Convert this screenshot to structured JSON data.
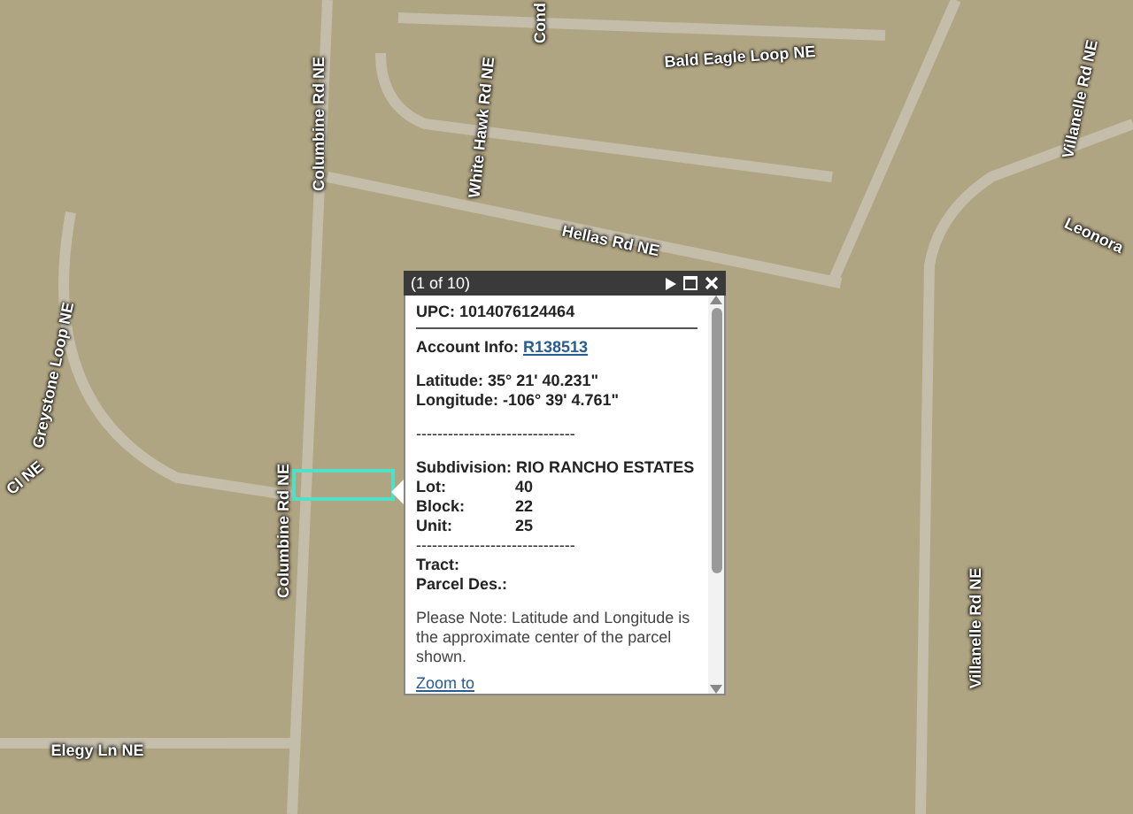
{
  "map": {
    "labels": [
      {
        "text": "Cond"
      },
      {
        "text": "Bald Eagle Loop NE"
      },
      {
        "text": "Columbine Rd NE"
      },
      {
        "text": "White Hawk Rd NE"
      },
      {
        "text": "Hellas Rd NE"
      },
      {
        "text": "Villanelle Rd NE"
      },
      {
        "text": "Leonora"
      },
      {
        "text": "Greystone Loop NE"
      },
      {
        "text": "Cl NE"
      },
      {
        "text": "Columbine Rd NE"
      },
      {
        "text": "Elegy Ln NE"
      },
      {
        "text": "Villanelle Rd NE"
      }
    ]
  },
  "popup": {
    "counter": "(1 of 10)",
    "lines": [
      {
        "kind": "field",
        "label": "UPC:",
        "value": "1014076124464"
      },
      {
        "kind": "rule"
      },
      {
        "kind": "link-field",
        "label": "Account Info:",
        "value": "R138513"
      },
      {
        "kind": "gap"
      },
      {
        "kind": "field",
        "label": "Latitude:",
        "value": "35° 21' 40.231\""
      },
      {
        "kind": "field",
        "label": "Longitude:",
        "value": "-106° 39' 4.761\""
      },
      {
        "kind": "gap"
      },
      {
        "kind": "dashes",
        "text": "------------------------------"
      },
      {
        "kind": "gap"
      },
      {
        "kind": "field",
        "label": "Subdivision:",
        "value": "RIO RANCHO ESTATES"
      },
      {
        "kind": "column",
        "label": "Lot:",
        "value": "40"
      },
      {
        "kind": "column",
        "label": "Block:",
        "value": "22"
      },
      {
        "kind": "column",
        "label": "Unit:",
        "value": "25"
      },
      {
        "kind": "dashes",
        "text": "------------------------------"
      },
      {
        "kind": "field",
        "label": "Tract:"
      },
      {
        "kind": "field",
        "label": "Parcel Des.:"
      },
      {
        "kind": "gap"
      },
      {
        "kind": "note",
        "text": "Please Note: Latitude and Longitude is the approximate center of the parcel shown."
      },
      {
        "kind": "link",
        "text": "Zoom to"
      }
    ]
  }
}
